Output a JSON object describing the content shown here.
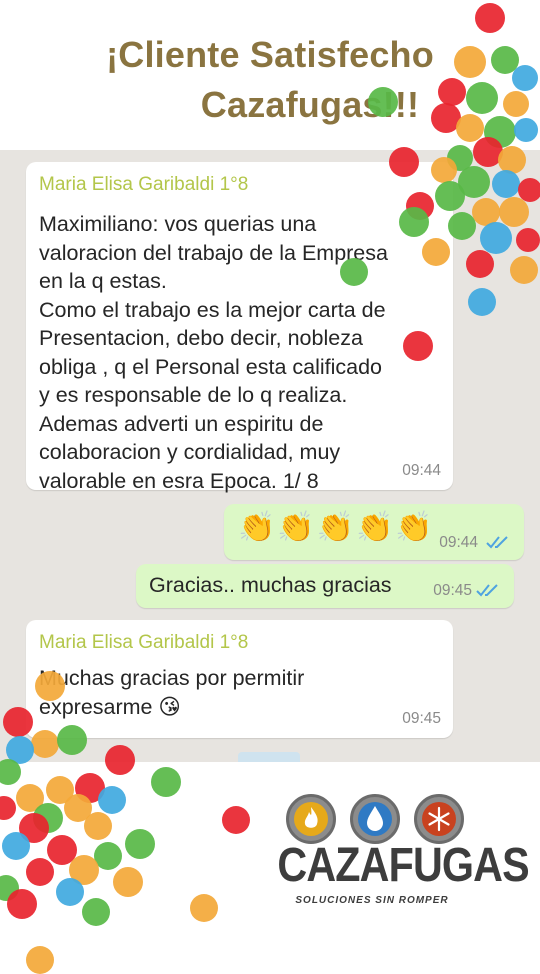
{
  "headline": {
    "line1": "¡Cliente Satisfecho",
    "line2": "Cazafugas!!!"
  },
  "messages": [
    {
      "sender": "Maria Elisa Garibaldi 1°8",
      "text": "Maximiliano: vos querias una\nvaloracion del trabajo de la Empresa\nen la q estas.\nComo el trabajo es la mejor carta de\nPresentacion, debo decir, nobleza\nobliga , q el Personal esta calificado\ny es responsable de lo q realiza.\nAdemas adverti un espiritu de\ncolaboracion y cordialidad, muy\nvalorable en esra Epoca. 1/ 8",
      "time": "09:44"
    },
    {
      "text": "👏👏👏👏👏",
      "time": "09:44"
    },
    {
      "text": "Gracias.. muchas gracias",
      "time": "09:45"
    },
    {
      "sender": "Maria Elisa Garibaldi 1°8",
      "text": "Muchas gracias por permitir\nexpresarme 😘",
      "time": "09:45"
    }
  ],
  "brand": {
    "name": "CAZAFUGAS",
    "tagline": "SOLUCIONES SIN ROMPER",
    "icons": [
      "fire-icon",
      "water-drop-icon",
      "snowflake-icon"
    ]
  },
  "colors": {
    "headline": "#8a7440",
    "sender": "#b3c64a",
    "outgoing_bubble": "#dcf8c6",
    "chat_background": "#e7e4e0",
    "read_ticks": "#4fa3e0"
  }
}
